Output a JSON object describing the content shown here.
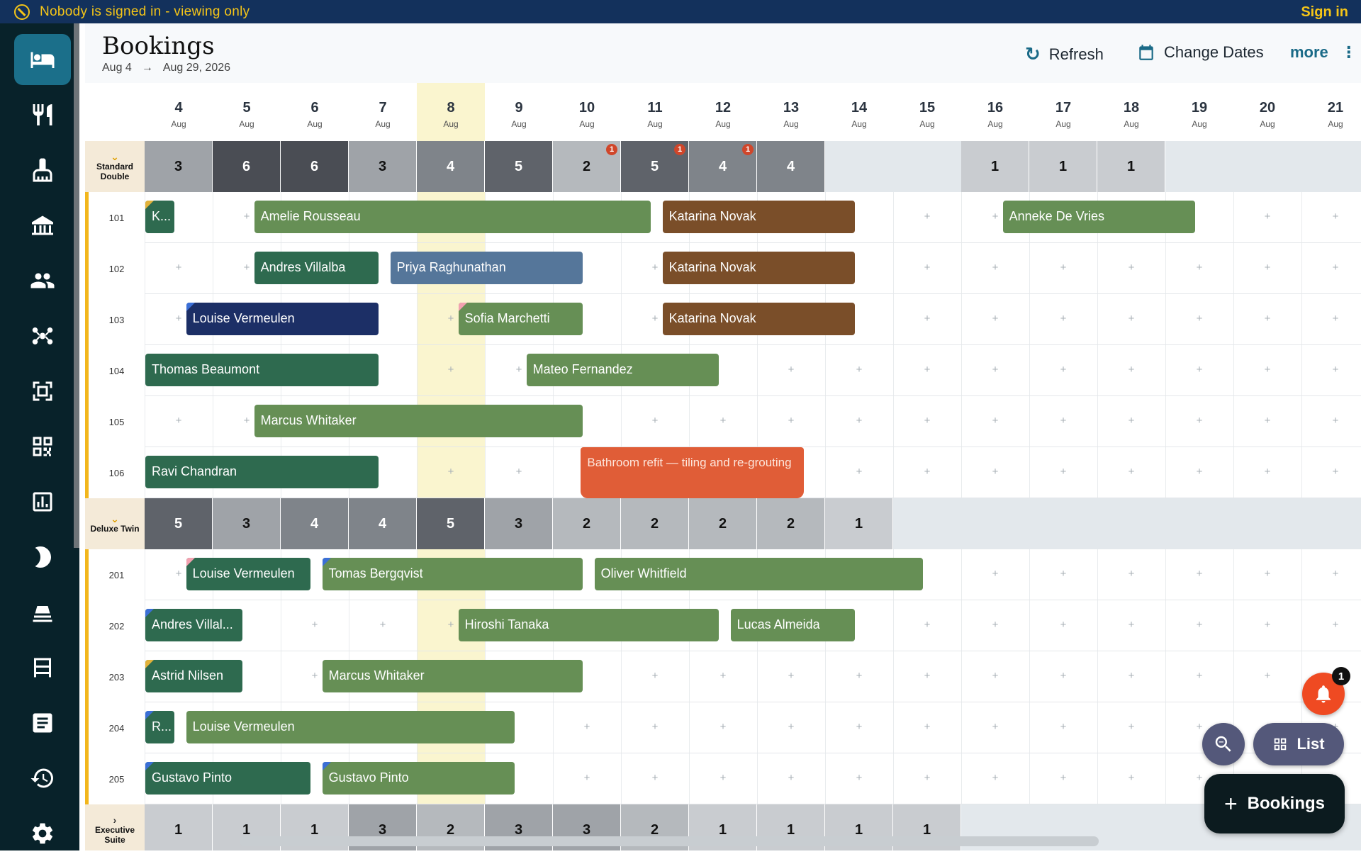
{
  "banner": {
    "message": "Nobody is signed in - viewing only",
    "signin": "Sign in",
    "icon": "no-sign-icon"
  },
  "sidebar": {
    "items": [
      "bed-icon",
      "restaurant-icon",
      "cleaning-icon",
      "property-icon",
      "guests-icon",
      "channels-icon",
      "scanner-icon",
      "qr-icon",
      "reports-icon",
      "night-audit-icon",
      "housekeeping-icon",
      "rooms-icon",
      "invoices-icon",
      "history-icon",
      "settings-icon"
    ]
  },
  "header": {
    "title": "Bookings",
    "from": "Aug 4",
    "arrow": "→",
    "to": "Aug 29, 2026",
    "refresh": "Refresh",
    "change_dates": "Change Dates",
    "more": "more"
  },
  "calendar": {
    "days": [
      4,
      5,
      6,
      7,
      8,
      9,
      10,
      11,
      12,
      13,
      14,
      15,
      16,
      17,
      18,
      19,
      20,
      21
    ],
    "month": "Aug",
    "today_index": 4,
    "groups": [
      {
        "name": "Standard Double",
        "expanded": true,
        "availability": [
          3,
          6,
          6,
          3,
          4,
          5,
          2,
          5,
          4,
          4,
          null,
          null,
          1,
          1,
          1,
          null,
          null,
          null
        ],
        "badges": [
          6,
          7,
          8
        ],
        "rooms": [
          {
            "number": "101",
            "bookings": [
              {
                "guest": "K...",
                "start": 0,
                "end": 0.45,
                "color": "c-dg",
                "tri": "#e2b23a"
              },
              {
                "guest": "Amelie Rousseau",
                "start": 1.6,
                "end": 7.45,
                "color": "c-g"
              },
              {
                "guest": "Katarina Novak",
                "start": 7.6,
                "end": 10.45,
                "color": "c-br"
              },
              {
                "guest": "Anneke De Vries",
                "start": 12.6,
                "end": 15.45,
                "color": "c-g"
              }
            ]
          },
          {
            "number": "102",
            "bookings": [
              {
                "guest": "Andres Villalba",
                "start": 1.6,
                "end": 3.45,
                "color": "c-dg"
              },
              {
                "guest": "Priya Raghunathan",
                "start": 3.6,
                "end": 6.45,
                "color": "c-bl"
              },
              {
                "guest": "Katarina Novak",
                "start": 7.6,
                "end": 10.45,
                "color": "c-br"
              }
            ]
          },
          {
            "number": "103",
            "bookings": [
              {
                "guest": "Louise Vermeulen",
                "start": 0.6,
                "end": 3.45,
                "color": "c-nv",
                "tri": "#3b6fd6"
              },
              {
                "guest": "Sofia Marchetti",
                "start": 4.6,
                "end": 6.45,
                "color": "c-g",
                "tri": "#f2a1b0"
              },
              {
                "guest": "Katarina Novak",
                "start": 7.6,
                "end": 10.45,
                "color": "c-br"
              }
            ]
          },
          {
            "number": "104",
            "bookings": [
              {
                "guest": "Thomas Beaumont",
                "start": 0,
                "end": 3.45,
                "color": "c-dg"
              },
              {
                "guest": "Mateo Fernandez",
                "start": 5.6,
                "end": 8.45,
                "color": "c-g"
              }
            ]
          },
          {
            "number": "105",
            "bookings": [
              {
                "guest": "Marcus Whitaker",
                "start": 1.6,
                "end": 6.45,
                "color": "c-g"
              }
            ]
          },
          {
            "number": "106",
            "bookings": [
              {
                "guest": "Ravi Chandran",
                "start": 0,
                "end": 3.45,
                "color": "c-dg"
              },
              {
                "guest": "Bathroom refit — tiling and re-grouting",
                "start": 6.4,
                "end": 9.7,
                "color": "c-or"
              }
            ]
          }
        ]
      },
      {
        "name": "Deluxe Twin",
        "expanded": true,
        "availability": [
          5,
          3,
          4,
          4,
          5,
          3,
          2,
          2,
          2,
          2,
          1,
          null,
          null,
          null,
          null,
          null,
          null,
          null
        ],
        "badges": [],
        "rooms": [
          {
            "number": "201",
            "bookings": [
              {
                "guest": "Louise Vermeulen",
                "start": 0.6,
                "end": 2.45,
                "color": "c-dg",
                "tri": "#f2a1b0"
              },
              {
                "guest": "Tomas Bergqvist",
                "start": 2.6,
                "end": 6.45,
                "color": "c-g",
                "tri": "#3b6fd6"
              },
              {
                "guest": "Oliver Whitfield",
                "start": 6.6,
                "end": 11.45,
                "color": "c-g"
              }
            ]
          },
          {
            "number": "202",
            "bookings": [
              {
                "guest": "Andres Villal...",
                "start": 0,
                "end": 1.45,
                "color": "c-dg",
                "tri": "#3b6fd6"
              },
              {
                "guest": "Hiroshi Tanaka",
                "start": 4.6,
                "end": 8.45,
                "color": "c-g"
              },
              {
                "guest": "Lucas Almeida",
                "start": 8.6,
                "end": 10.45,
                "color": "c-g"
              }
            ]
          },
          {
            "number": "203",
            "bookings": [
              {
                "guest": "Astrid Nilsen",
                "start": 0,
                "end": 1.45,
                "color": "c-dg",
                "tri": "#e2b23a"
              },
              {
                "guest": "Marcus Whitaker",
                "start": 2.6,
                "end": 6.45,
                "color": "c-g"
              }
            ]
          },
          {
            "number": "204",
            "bookings": [
              {
                "guest": "R...",
                "start": 0,
                "end": 0.45,
                "color": "c-dg",
                "tri": "#3b6fd6"
              },
              {
                "guest": "Louise Vermeulen",
                "start": 0.6,
                "end": 5.45,
                "color": "c-g"
              }
            ]
          },
          {
            "number": "205",
            "bookings": [
              {
                "guest": "Gustavo Pinto",
                "start": 0,
                "end": 2.45,
                "color": "c-dg",
                "tri": "#3b6fd6"
              },
              {
                "guest": "Gustavo Pinto",
                "start": 2.6,
                "end": 5.45,
                "color": "c-g",
                "tri": "#3b6fd6"
              }
            ]
          }
        ]
      },
      {
        "name": "Executive Suite",
        "expanded": false,
        "availability": [
          1,
          1,
          1,
          3,
          2,
          3,
          3,
          2,
          1,
          1,
          1,
          1,
          null,
          null,
          null,
          null,
          null,
          null
        ],
        "badges": [],
        "rooms": []
      }
    ]
  },
  "floating": {
    "bell_count": "1",
    "list": "List",
    "bookings": "Bookings"
  }
}
